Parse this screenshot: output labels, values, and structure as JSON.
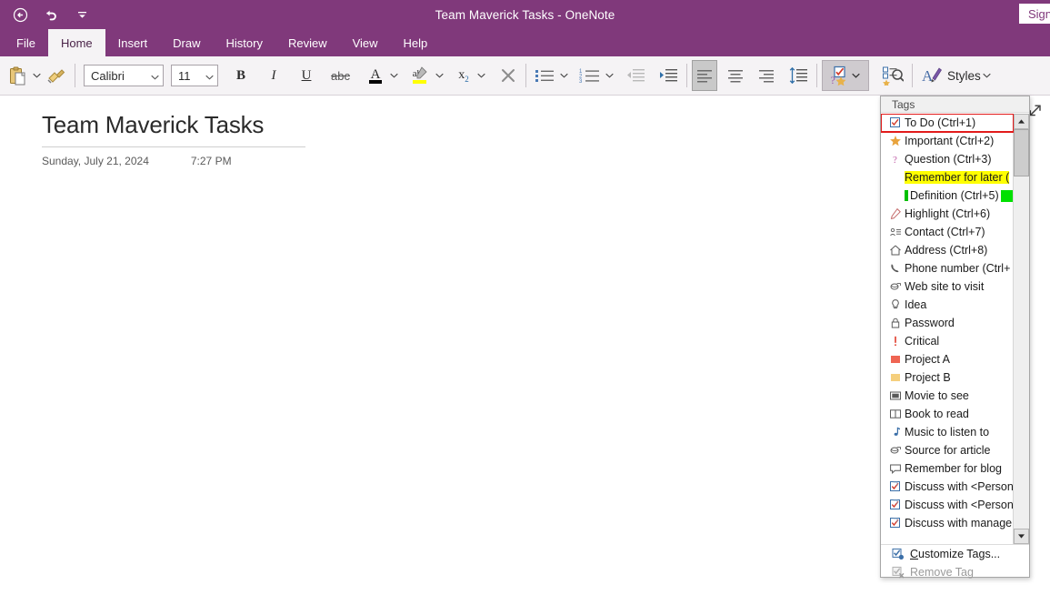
{
  "window": {
    "title": "Team Maverick Tasks  -  OneNote",
    "signin_label": "Sign i",
    "accent_color": "#80397b",
    "back_icon": "back-circle-icon",
    "undo_icon": "undo-icon",
    "qat_more_icon": "quick-access-more-icon"
  },
  "ribbon_tabs": [
    {
      "label": "File",
      "active": false
    },
    {
      "label": "Home",
      "active": true
    },
    {
      "label": "Insert",
      "active": false
    },
    {
      "label": "Draw",
      "active": false
    },
    {
      "label": "History",
      "active": false
    },
    {
      "label": "Review",
      "active": false
    },
    {
      "label": "View",
      "active": false
    },
    {
      "label": "Help",
      "active": false
    }
  ],
  "ribbon": {
    "paste_icon": "clipboard-paste-icon",
    "format_painter_icon": "format-painter-icon",
    "font": {
      "value": "Calibri",
      "placeholder": "Font"
    },
    "size": {
      "value": "11",
      "placeholder": "Size"
    },
    "bold_label": "B",
    "italic_label": "I",
    "underline_label": "U",
    "strikethrough_label": "abc",
    "font_color_label": "A",
    "highlight_label": "ab",
    "subscript_label": "x",
    "subscript_sub": "2",
    "clear_formatting_icon": "clear-formatting-x-icon",
    "bullets_icon": "bullet-list-icon",
    "numbering_icon": "numbered-list-icon",
    "decrease_indent_icon": "decrease-indent-icon",
    "increase_indent_icon": "increase-indent-icon",
    "align_left_icon": "align-left-icon",
    "align_center_icon": "align-center-icon",
    "align_right_icon": "align-right-icon",
    "line_spacing_icon": "line-spacing-icon",
    "tags_icon": "tags-icon",
    "find_tags_icon": "find-tags-icon",
    "styles_icon": "styles-icon",
    "styles_label": "Styles"
  },
  "page": {
    "title": "Team Maverick Tasks",
    "date": "Sunday, July 21, 2024",
    "time": "7:27 PM",
    "expand_icon": "expand-arrow-icon"
  },
  "tags_menu": {
    "header": "Tags",
    "items": [
      {
        "label": "To Do (Ctrl+1)",
        "icon": "checkbox-todo-icon",
        "selected": true
      },
      {
        "label": "Important (Ctrl+2)",
        "icon": "star-icon"
      },
      {
        "label": "Question (Ctrl+3)",
        "icon": "question-mark-icon"
      },
      {
        "label": "Remember for later (",
        "icon": "none",
        "highlight": "yellow"
      },
      {
        "label": "Definition (Ctrl+5)",
        "icon": "none",
        "highlight": "green-bar",
        "swatch": "green"
      },
      {
        "label": "Highlight (Ctrl+6)",
        "icon": "highlighter-pen-icon"
      },
      {
        "label": "Contact (Ctrl+7)",
        "icon": "contact-card-icon"
      },
      {
        "label": "Address (Ctrl+8)",
        "icon": "house-address-icon"
      },
      {
        "label": "Phone number (Ctrl+",
        "icon": "phone-icon"
      },
      {
        "label": "Web site to visit",
        "icon": "globe-link-icon"
      },
      {
        "label": "Idea",
        "icon": "lightbulb-icon"
      },
      {
        "label": "Password",
        "icon": "lock-icon"
      },
      {
        "label": "Critical",
        "icon": "exclamation-icon"
      },
      {
        "label": "Project A",
        "icon": "red-square-icon"
      },
      {
        "label": "Project B",
        "icon": "yellow-square-icon"
      },
      {
        "label": "Movie to see",
        "icon": "film-icon"
      },
      {
        "label": "Book to read",
        "icon": "book-icon"
      },
      {
        "label": "Music to listen to",
        "icon": "music-note-icon"
      },
      {
        "label": "Source for article",
        "icon": "globe-link-icon"
      },
      {
        "label": "Remember for blog",
        "icon": "speech-bubble-icon"
      },
      {
        "label": "Discuss with <Person",
        "icon": "discuss-checkbox-icon"
      },
      {
        "label": "Discuss with <Person",
        "icon": "discuss-checkbox-icon"
      },
      {
        "label": "Discuss with manage",
        "icon": "discuss-checkbox-icon"
      }
    ],
    "footer": [
      {
        "label": "Customize Tags...",
        "icon": "customize-tags-icon",
        "disabled": false,
        "accel": "C"
      },
      {
        "label": "Remove Tag",
        "icon": "remove-tag-icon",
        "disabled": true,
        "accel": "g"
      }
    ],
    "scrollbar": {
      "up_icon": "scroll-up-arrow-icon",
      "down_icon": "scroll-down-arrow-icon"
    },
    "selection_outline_color": "#e21b1b"
  }
}
